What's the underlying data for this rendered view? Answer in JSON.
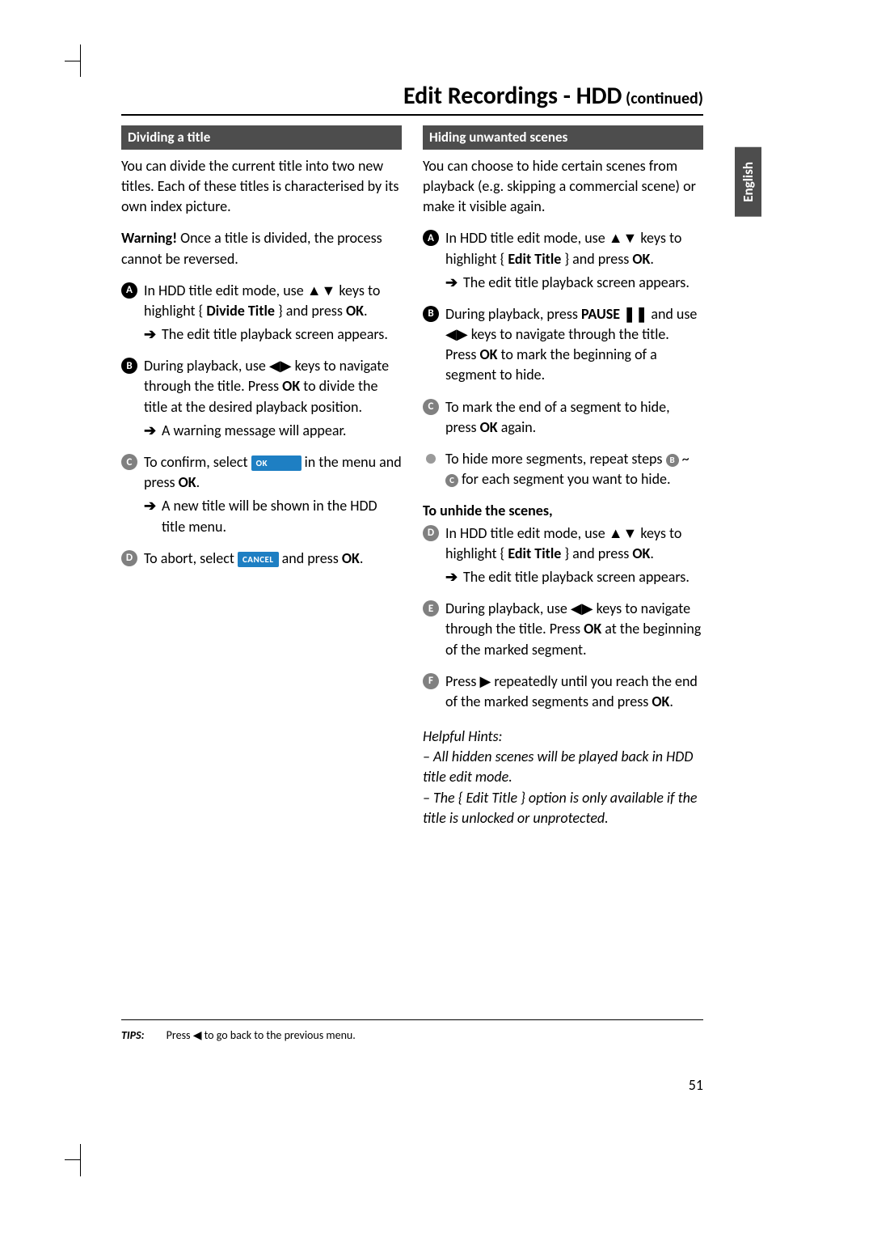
{
  "header": {
    "title": "Edit Recordings - HDD",
    "continued": " (continued)"
  },
  "sideTab": "English",
  "pageNumber": "51",
  "tips": {
    "label": "TIPS:",
    "text_a": "Press ",
    "text_b": " to go back to the previous menu."
  },
  "left": {
    "heading": "Dividing a title",
    "intro": "You can divide the current title into two new titles. Each of these titles is characterised by its own index picture.",
    "warning_label": "Warning!",
    "warning_text": " Once a title is divided, the process cannot be reversed.",
    "s1_a": "In HDD title edit mode, use ",
    "s1_b": " keys to highlight { ",
    "s1_menu": "Divide Title",
    "s1_c": " } and press ",
    "s1_ok": "OK",
    "s1_d": ".",
    "s1_res": "The edit title playback screen appears.",
    "s2_a": "During playback, use ",
    "s2_b": " keys to navigate through the title. Press ",
    "s2_ok": "OK",
    "s2_c": " to divide the title at the desired playback position.",
    "s2_res": "A warning message will appear.",
    "s3_a": "To confirm, select ",
    "s3_btn": "OK",
    "s3_b": " in the menu and press ",
    "s3_ok": "OK",
    "s3_c": ".",
    "s3_res": "A new title will be shown in the HDD title menu.",
    "s4_a": "To abort, select ",
    "s4_btn": "CANCEL",
    "s4_b": " and press ",
    "s4_ok": "OK",
    "s4_c": "."
  },
  "right": {
    "heading": "Hiding unwanted scenes",
    "intro": "You can choose to hide certain scenes from playback (e.g. skipping a commercial scene) or make it visible again.",
    "s1_a": "In HDD title edit mode, use ",
    "s1_b": " keys to highlight { ",
    "s1_menu": "Edit Title",
    "s1_c": " } and press ",
    "s1_ok": "OK",
    "s1_d": ".",
    "s1_res": "The edit title playback screen appears.",
    "s2_a": "During playback, press ",
    "s2_pause": "PAUSE",
    "s2_b": " and use ",
    "s2_c": " keys to navigate through the title. Press ",
    "s2_ok": "OK",
    "s2_d": " to mark the beginning of a segment to hide.",
    "s3_a": "To mark the end of a segment to hide, press ",
    "s3_ok": "OK",
    "s3_b": " again.",
    "bullet_a": "To hide more segments, repeat steps ",
    "bullet_b": " ~ ",
    "bullet_c": " for each segment you want to hide.",
    "unhide_head": "To unhide the scenes,",
    "s4_a": "In HDD title edit mode, use ",
    "s4_b": " keys to highlight { ",
    "s4_menu": "Edit Title",
    "s4_c": " } and press ",
    "s4_ok": "OK",
    "s4_d": ".",
    "s4_res": "The edit title playback screen appears.",
    "s5_a": "During playback, use ",
    "s5_b": " keys to navigate through the title. Press ",
    "s5_ok": "OK",
    "s5_c": " at the beginning of the marked segment.",
    "s6_a": "Press ",
    "s6_b": " repeatedly until you reach the end of the marked segments and press ",
    "s6_ok": "OK",
    "s6_c": ".",
    "hints_label": "Helpful Hints:",
    "hint1": "– All hidden scenes will be played back in HDD title edit mode.",
    "hint2": "– The { Edit Title } option is only available if the title is unlocked or unprotected."
  }
}
